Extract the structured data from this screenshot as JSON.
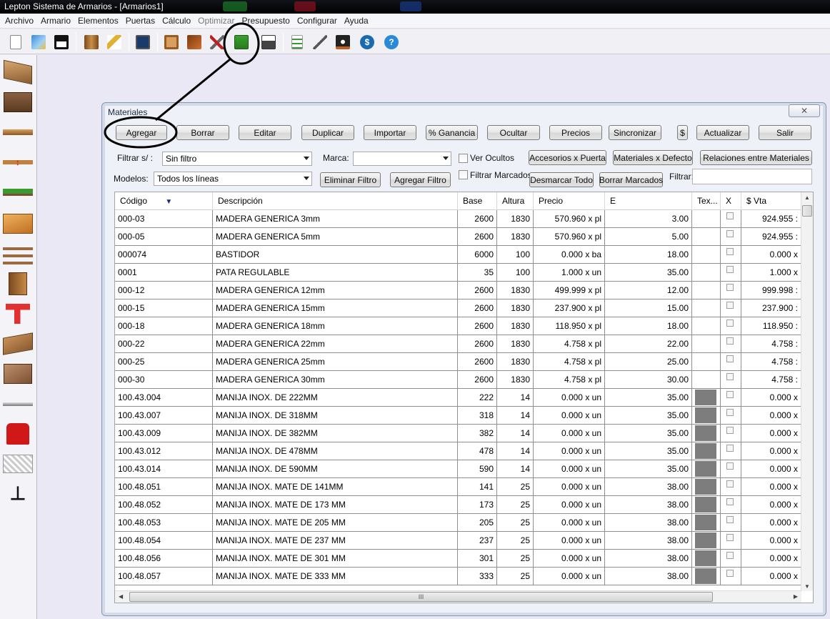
{
  "app": {
    "title": "Lepton Sistema de Armarios - [Armarios1]"
  },
  "menu": [
    "Archivo",
    "Armario",
    "Elementos",
    "Puertas",
    "Cálculo",
    "Optimizar",
    "Presupuesto",
    "Configurar",
    "Ayuda"
  ],
  "dialog": {
    "title": "Materiales",
    "close": "✕",
    "buttons": {
      "agregar": "Agregar",
      "borrar": "Borrar",
      "editar": "Editar",
      "duplicar": "Duplicar",
      "importar": "Importar",
      "ganancia": "% Ganancia",
      "ocultar": "Ocultar",
      "precios": "Precios",
      "sincronizar": "Sincronizar",
      "dollar": "$",
      "actualizar": "Actualizar",
      "salir": "Salir",
      "accesorios": "Accesorios x Puerta",
      "materiales_defecto": "Materiales x Defecto",
      "relaciones": "Relaciones entre Materiales",
      "eliminar_filtro": "Eliminar Filtro",
      "agregar_filtro": "Agregar Filtro",
      "desmarcar": "Desmarcar Todo",
      "borrar_marcados": "Borrar Marcados"
    },
    "filters": {
      "filtrar_label": "Filtrar s/ :",
      "filtrar_value": "Sin filtro",
      "marca_label": "Marca:",
      "marca_value": "",
      "ver_ocultos": "Ver Ocultos",
      "filtrar_marcados": "Filtrar Marcados",
      "modelos_label": "Modelos:",
      "modelos_value": "Todos los líneas",
      "filtrar_text_label": "Filtrar:",
      "filtrar_text_value": ""
    },
    "columns": [
      "Código",
      "Descripción",
      "Base",
      "Altura",
      "Precio",
      "E",
      "Tex...",
      "X",
      "$ Vta"
    ],
    "sort_indicator": "▼",
    "rows": [
      {
        "codigo": "000-03",
        "desc": "MADERA GENERICA 3mm",
        "base": "2600",
        "altura": "1830",
        "precio": "570.960 x pl",
        "e": "3.00",
        "tex": false,
        "vta": "924.955 :"
      },
      {
        "codigo": "000-05",
        "desc": "MADERA GENERICA 5mm",
        "base": "2600",
        "altura": "1830",
        "precio": "570.960 x pl",
        "e": "5.00",
        "tex": false,
        "vta": "924.955 :"
      },
      {
        "codigo": "000074",
        "desc": "BASTIDOR",
        "base": "6000",
        "altura": "100",
        "precio": "0.000 x ba",
        "e": "18.00",
        "tex": false,
        "vta": "0.000 x"
      },
      {
        "codigo": "0001",
        "desc": "PATA REGULABLE",
        "base": "35",
        "altura": "100",
        "precio": "1.000 x un",
        "e": "35.00",
        "tex": false,
        "vta": "1.000 x"
      },
      {
        "codigo": "000-12",
        "desc": "MADERA GENERICA 12mm",
        "base": "2600",
        "altura": "1830",
        "precio": "499.999 x pl",
        "e": "12.00",
        "tex": false,
        "vta": "999.998 :"
      },
      {
        "codigo": "000-15",
        "desc": "MADERA GENERICA 15mm",
        "base": "2600",
        "altura": "1830",
        "precio": "237.900 x pl",
        "e": "15.00",
        "tex": false,
        "vta": "237.900 :"
      },
      {
        "codigo": "000-18",
        "desc": "MADERA GENERICA 18mm",
        "base": "2600",
        "altura": "1830",
        "precio": "118.950 x pl",
        "e": "18.00",
        "tex": false,
        "vta": "118.950 :"
      },
      {
        "codigo": "000-22",
        "desc": "MADERA GENERICA 22mm",
        "base": "2600",
        "altura": "1830",
        "precio": "4.758 x pl",
        "e": "22.00",
        "tex": false,
        "vta": "4.758 :"
      },
      {
        "codigo": "000-25",
        "desc": "MADERA GENERICA 25mm",
        "base": "2600",
        "altura": "1830",
        "precio": "4.758 x pl",
        "e": "25.00",
        "tex": false,
        "vta": "4.758 :"
      },
      {
        "codigo": "000-30",
        "desc": "MADERA GENERICA 30mm",
        "base": "2600",
        "altura": "1830",
        "precio": "4.758 x pl",
        "e": "30.00",
        "tex": false,
        "vta": "4.758 :"
      },
      {
        "codigo": "100.43.004",
        "desc": "MANIJA INOX. DE 222MM",
        "base": "222",
        "altura": "14",
        "precio": "0.000 x un",
        "e": "35.00",
        "tex": true,
        "vta": "0.000 x"
      },
      {
        "codigo": "100.43.007",
        "desc": "MANIJA INOX. DE 318MM",
        "base": "318",
        "altura": "14",
        "precio": "0.000 x un",
        "e": "35.00",
        "tex": true,
        "vta": "0.000 x"
      },
      {
        "codigo": "100.43.009",
        "desc": "MANIJA INOX. DE 382MM",
        "base": "382",
        "altura": "14",
        "precio": "0.000 x un",
        "e": "35.00",
        "tex": true,
        "vta": "0.000 x"
      },
      {
        "codigo": "100.43.012",
        "desc": "MANIJA INOX. DE 478MM",
        "base": "478",
        "altura": "14",
        "precio": "0.000 x un",
        "e": "35.00",
        "tex": true,
        "vta": "0.000 x"
      },
      {
        "codigo": "100.43.014",
        "desc": "MANIJA INOX. DE 590MM",
        "base": "590",
        "altura": "14",
        "precio": "0.000 x un",
        "e": "35.00",
        "tex": true,
        "vta": "0.000 x"
      },
      {
        "codigo": "100.48.051",
        "desc": "MANIJA INOX. MATE DE 141MM",
        "base": "141",
        "altura": "25",
        "precio": "0.000 x un",
        "e": "38.00",
        "tex": true,
        "vta": "0.000 x"
      },
      {
        "codigo": "100.48.052",
        "desc": "MANIJA INOX. MATE DE 173 MM",
        "base": "173",
        "altura": "25",
        "precio": "0.000 x un",
        "e": "38.00",
        "tex": true,
        "vta": "0.000 x"
      },
      {
        "codigo": "100.48.053",
        "desc": "MANIJA INOX. MATE DE 205 MM",
        "base": "205",
        "altura": "25",
        "precio": "0.000 x un",
        "e": "38.00",
        "tex": true,
        "vta": "0.000 x"
      },
      {
        "codigo": "100.48.054",
        "desc": "MANIJA INOX. MATE DE 237 MM",
        "base": "237",
        "altura": "25",
        "precio": "0.000 x un",
        "e": "38.00",
        "tex": true,
        "vta": "0.000 x"
      },
      {
        "codigo": "100.48.056",
        "desc": "MANIJA INOX. MATE DE 301 MM",
        "base": "301",
        "altura": "25",
        "precio": "0.000 x un",
        "e": "38.00",
        "tex": true,
        "vta": "0.000 x"
      },
      {
        "codigo": "100.48.057",
        "desc": "MANIJA INOX. MATE DE 333 MM",
        "base": "333",
        "altura": "25",
        "precio": "0.000 x un",
        "e": "38.00",
        "tex": true,
        "vta": "0.000 x"
      }
    ],
    "scroll_grip": "III"
  },
  "toolbar_icons": [
    "new-document-icon",
    "open-icon",
    "save-icon",
    "wardrobe-icon",
    "measure-icon",
    "monitor-icon",
    "frame-icon",
    "panels-icon",
    "tools-icon",
    "materials-icon",
    "print-icon",
    "list-icon",
    "pencil-icon",
    "edge-band-icon",
    "money-icon",
    "help-icon"
  ],
  "sidebar_icons": [
    "cabinet-top-icon",
    "drawer-box-icon",
    "shelf-icon",
    "height-arrows-icon",
    "green-panel-icon",
    "door-panel-icon",
    "stacked-shelves-icon",
    "side-panel-icon",
    "red-bracket-icon",
    "tray-icon",
    "drawer-icon",
    "rod-icon",
    "shirt-icon",
    "rack-icon",
    "hanger-icon"
  ]
}
